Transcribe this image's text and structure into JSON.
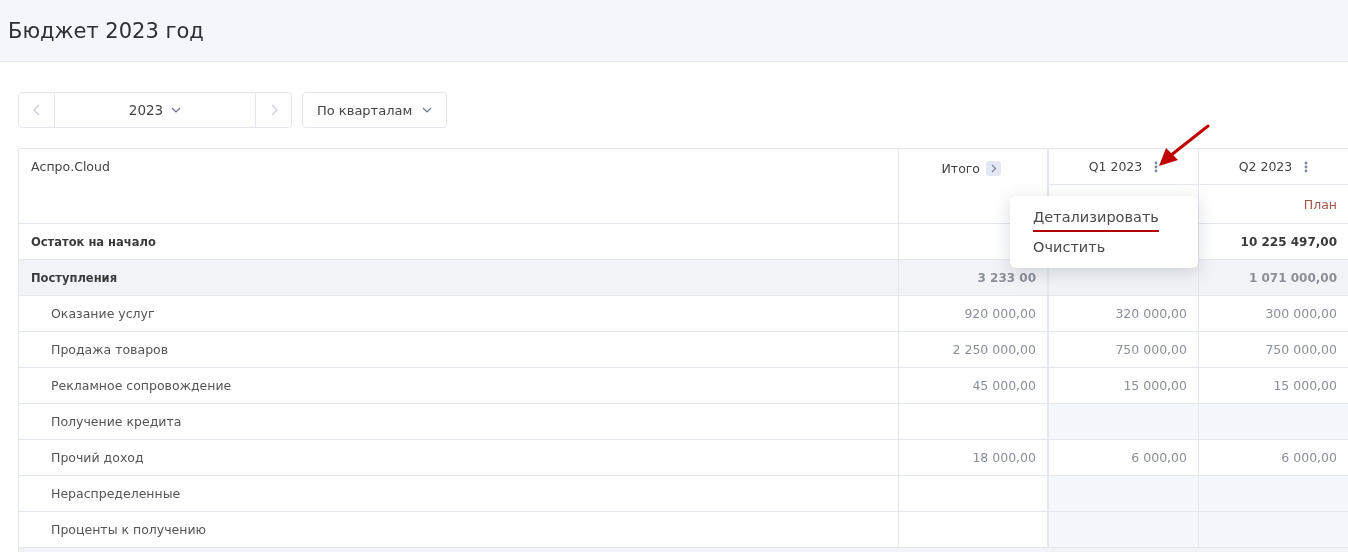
{
  "page": {
    "title": "Бюджет 2023 год"
  },
  "toolbar": {
    "year": "2023",
    "grouping": "По кварталам"
  },
  "table": {
    "corner": "Аспро.Cloud",
    "total_column": {
      "label": "Итого"
    },
    "periods": [
      {
        "label": "Q1 2023"
      },
      {
        "label": "Q2 2023",
        "sub": "План"
      }
    ],
    "rows": [
      {
        "kind": "section",
        "label": "Остаток на начало",
        "shaded": false,
        "q2": "10 225 497,00"
      },
      {
        "kind": "section",
        "label": "Поступления",
        "shaded": true,
        "total": "3 233 00",
        "q2": "1 071 000,00"
      },
      {
        "kind": "item",
        "label": "Оказание услуг",
        "shaded": false,
        "total": "920 000,00",
        "q1": "320 000,00",
        "q2": "300 000,00"
      },
      {
        "kind": "item",
        "label": "Продажа товаров",
        "shaded": false,
        "total": "2 250 000,00",
        "q1": "750 000,00",
        "q2": "750 000,00"
      },
      {
        "kind": "item",
        "label": "Рекламное сопровождение",
        "shaded": false,
        "total": "45 000,00",
        "q1": "15 000,00",
        "q2": "15 000,00"
      },
      {
        "kind": "item",
        "label": "Получение кредита",
        "shaded": false
      },
      {
        "kind": "item",
        "label": "Прочий доход",
        "shaded": false,
        "total": "18 000,00",
        "q1": "6 000,00",
        "q2": "6 000,00"
      },
      {
        "kind": "item",
        "label": "Нераспределенные",
        "shaded": false
      },
      {
        "kind": "item",
        "label": "Проценты к получению",
        "shaded": false
      }
    ]
  },
  "context_menu": {
    "items": [
      {
        "label": "Детализировать",
        "underlined": true
      },
      {
        "label": "Очистить",
        "underlined": false
      }
    ]
  }
}
